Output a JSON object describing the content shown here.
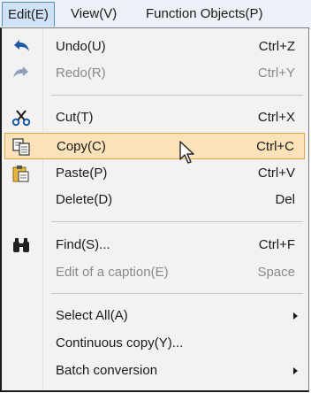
{
  "menubar": {
    "edit": "Edit(E)",
    "view": "View(V)",
    "function_objects": "Function Objects(P)"
  },
  "menu": {
    "items": [
      {
        "label": "Undo(U)",
        "shortcut": "Ctrl+Z",
        "icon": "undo-icon",
        "disabled": false
      },
      {
        "label": "Redo(R)",
        "shortcut": "Ctrl+Y",
        "icon": "redo-icon",
        "disabled": true
      },
      {
        "label": "Cut(T)",
        "shortcut": "Ctrl+X",
        "icon": "scissors-icon",
        "disabled": false
      },
      {
        "label": "Copy(C)",
        "shortcut": "Ctrl+C",
        "icon": "copy-icon",
        "disabled": false,
        "highlighted": true
      },
      {
        "label": "Paste(P)",
        "shortcut": "Ctrl+V",
        "icon": "paste-icon",
        "disabled": false
      },
      {
        "label": "Delete(D)",
        "shortcut": "Del",
        "icon": "",
        "disabled": false
      },
      {
        "label": "Find(S)...",
        "shortcut": "Ctrl+F",
        "icon": "binoculars-icon",
        "disabled": false
      },
      {
        "label": "Edit of a caption(E)",
        "shortcut": "Space",
        "icon": "",
        "disabled": true
      },
      {
        "label": "Select All(A)",
        "shortcut": "",
        "icon": "",
        "submenu": true
      },
      {
        "label": "Continuous copy(Y)...",
        "shortcut": "",
        "icon": ""
      },
      {
        "label": "Batch conversion",
        "shortcut": "",
        "icon": "",
        "submenu": true
      }
    ]
  },
  "colors": {
    "highlight_bg": "#fbe2b8",
    "highlight_border": "#e0a64a",
    "menubar_active": "#cfe2f6"
  }
}
